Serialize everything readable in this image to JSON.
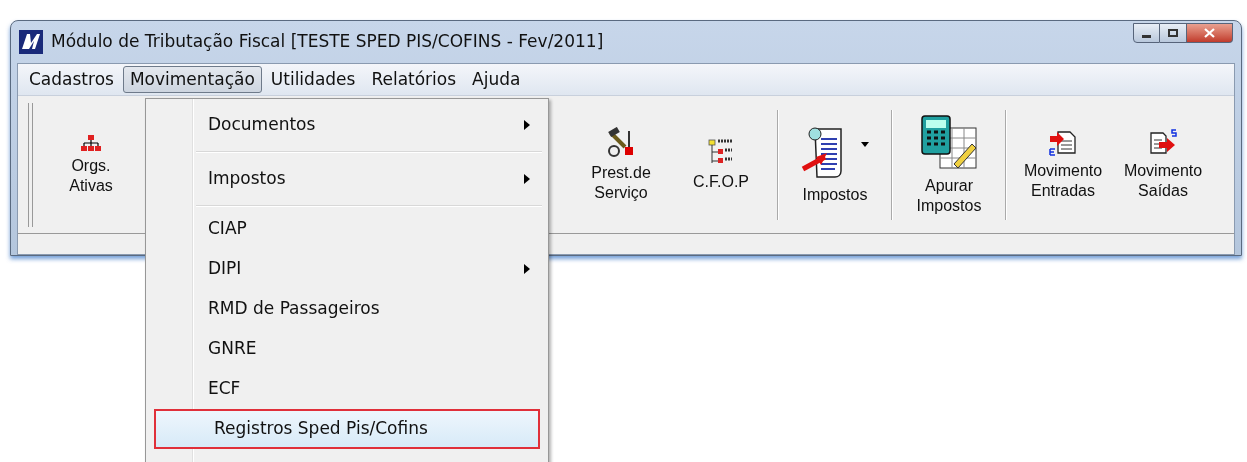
{
  "window": {
    "title": "Módulo de Tributação Fiscal [TESTE SPED PIS/COFINS - Fev/2011]"
  },
  "menubar": [
    {
      "label": "Cadastros",
      "selected": false
    },
    {
      "label": "Movimentação",
      "selected": true
    },
    {
      "label": "Utilidades",
      "selected": false
    },
    {
      "label": "Relatórios",
      "selected": false
    },
    {
      "label": "Ajuda",
      "selected": false
    }
  ],
  "toolbar": [
    {
      "kind": "button",
      "lines": [
        "Orgs.",
        "Ativas"
      ],
      "dropdown": false
    },
    {
      "kind": "hidden"
    },
    {
      "kind": "button",
      "lines": [
        "Prest.de",
        "Serviço"
      ],
      "dropdown": false
    },
    {
      "kind": "button",
      "lines": [
        "C.F.O.P"
      ],
      "dropdown": false
    },
    {
      "kind": "separator"
    },
    {
      "kind": "button",
      "lines": [
        "Impostos"
      ],
      "dropdown": true
    },
    {
      "kind": "separator"
    },
    {
      "kind": "button",
      "lines": [
        "Apurar",
        "Impostos"
      ],
      "dropdown": false
    },
    {
      "kind": "separator"
    },
    {
      "kind": "button",
      "lines": [
        "Movimento",
        "Entradas"
      ],
      "dropdown": false
    },
    {
      "kind": "button",
      "lines": [
        "Movimento",
        "Saídas"
      ],
      "dropdown": false
    }
  ],
  "menu": [
    {
      "kind": "item",
      "label": "Documentos",
      "submenu": true,
      "selected": false
    },
    {
      "kind": "separator"
    },
    {
      "kind": "item",
      "label": "Impostos",
      "submenu": true,
      "selected": false
    },
    {
      "kind": "separator"
    },
    {
      "kind": "item",
      "label": "CIAP",
      "submenu": false,
      "selected": false
    },
    {
      "kind": "item",
      "label": "DIPI",
      "submenu": true,
      "selected": false
    },
    {
      "kind": "item",
      "label": "RMD de Passageiros",
      "submenu": false,
      "selected": false
    },
    {
      "kind": "item",
      "label": "GNRE",
      "submenu": false,
      "selected": false
    },
    {
      "kind": "item",
      "label": "ECF",
      "submenu": false,
      "selected": false
    },
    {
      "kind": "item",
      "label": "Registros Sped Pis/Cofins",
      "submenu": false,
      "selected": true
    }
  ]
}
